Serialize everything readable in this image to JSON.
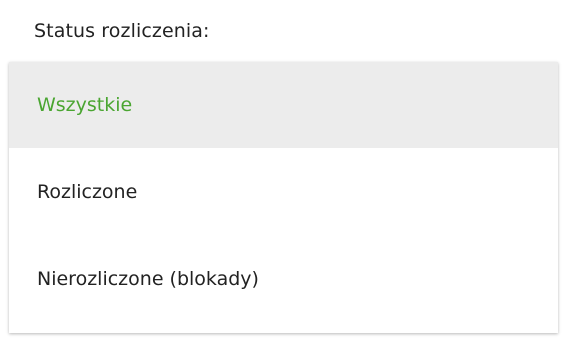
{
  "filter": {
    "label": "Status rozliczenia:",
    "selected_index": 0,
    "accent_color": "#4aa531",
    "options": [
      {
        "label": "Wszystkie",
        "selected": true
      },
      {
        "label": "Rozliczone",
        "selected": false
      },
      {
        "label": "Nierozliczone (blokady)",
        "selected": false
      }
    ]
  }
}
